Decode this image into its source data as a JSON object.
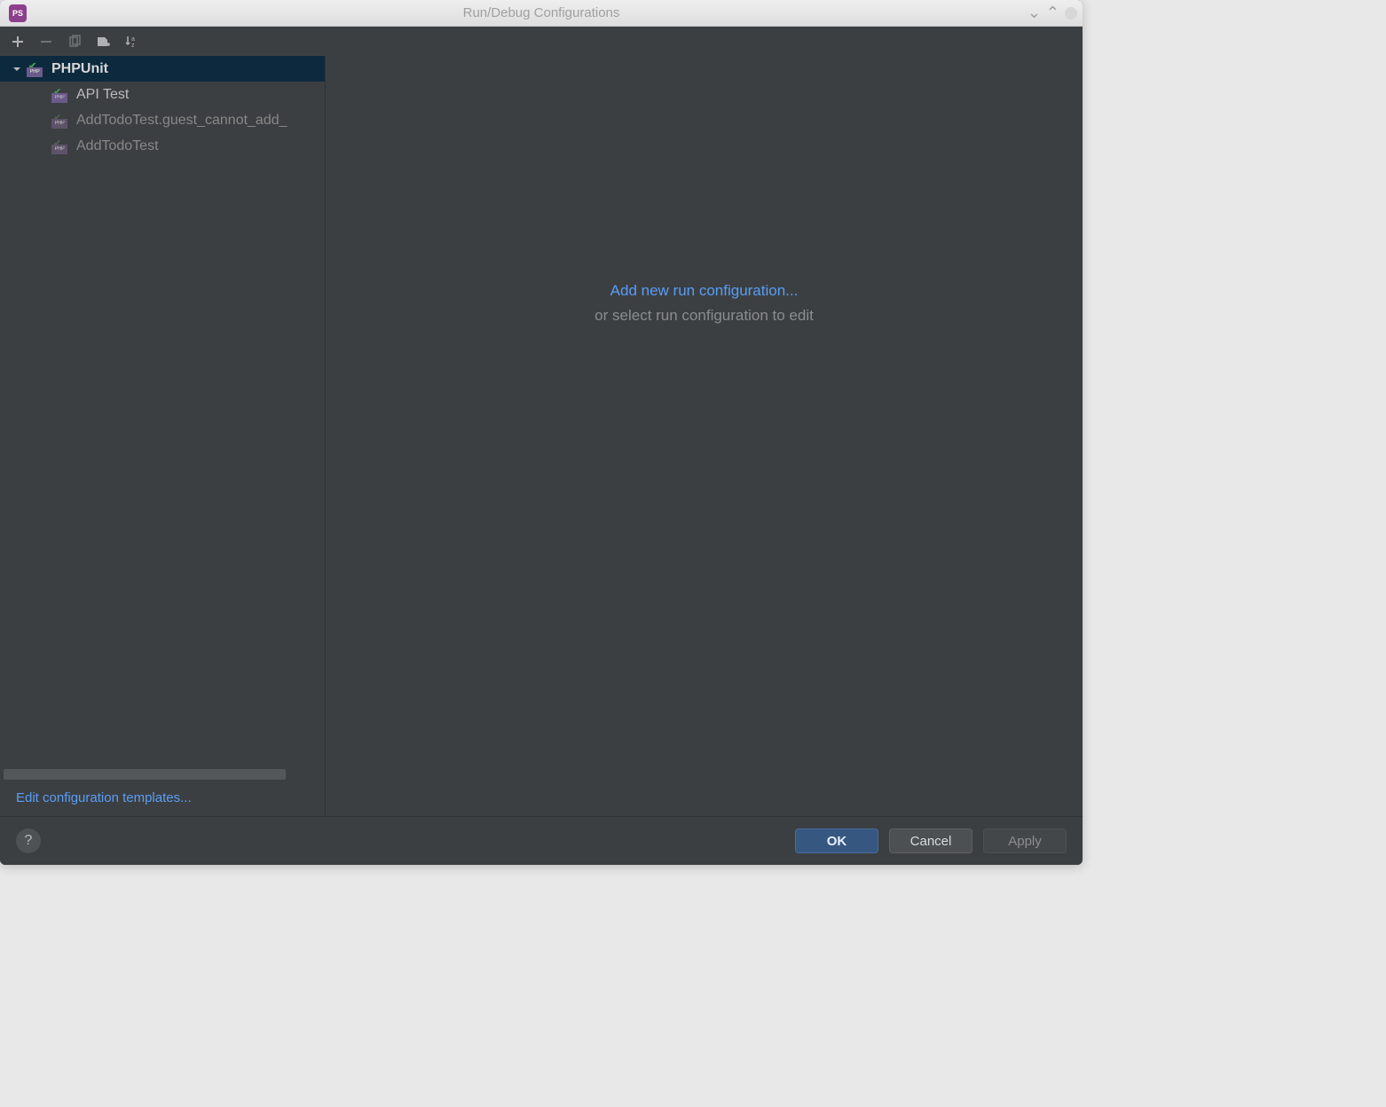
{
  "window": {
    "title": "Run/Debug Configurations"
  },
  "tree": {
    "group_label": "PHPUnit",
    "items": [
      {
        "label": "API Test"
      },
      {
        "label": "AddTodoTest.guest_cannot_add_"
      },
      {
        "label": "AddTodoTest"
      }
    ]
  },
  "sidebar": {
    "templates_link": "Edit configuration templates..."
  },
  "main": {
    "add_link": "Add new run configuration...",
    "subtitle": "or select run configuration to edit"
  },
  "footer": {
    "ok": "OK",
    "cancel": "Cancel",
    "apply": "Apply"
  }
}
